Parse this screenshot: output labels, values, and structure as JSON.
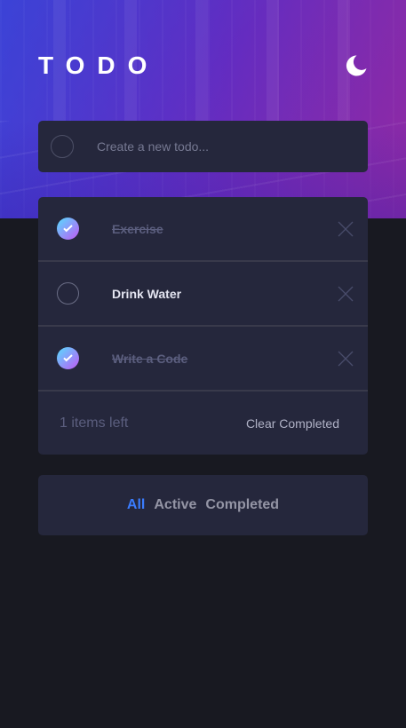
{
  "app": {
    "title": "TODO",
    "theme_icon": "moon-icon",
    "colors": {
      "background": "#181921",
      "card": "#25273c",
      "accent": "#3a7cfd",
      "check_gradient_start": "#57ddff",
      "check_gradient_end": "#c058f3"
    }
  },
  "new_todo": {
    "placeholder": "Create a new todo...",
    "value": ""
  },
  "todos": [
    {
      "label": "Exercise",
      "completed": true
    },
    {
      "label": "Drink Water",
      "completed": false
    },
    {
      "label": "Write a Code",
      "completed": true
    }
  ],
  "footer": {
    "items_left": "1 items left",
    "clear_label": "Clear Completed"
  },
  "filters": {
    "all": "All",
    "active": "Active",
    "completed": "Completed",
    "selected": "All"
  }
}
